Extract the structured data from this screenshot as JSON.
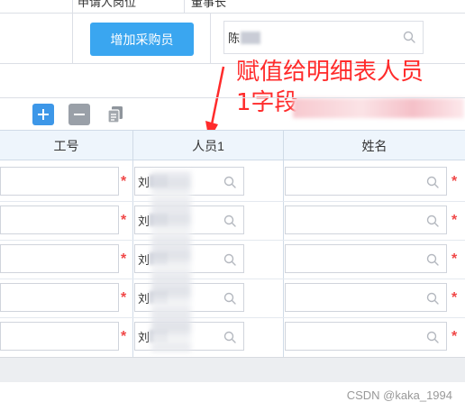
{
  "top_form": {
    "applicant_position_label": "申请人岗位",
    "applicant_position_value": "董事长",
    "add_buyer_button": "增加采购员",
    "person_field_value": "陈"
  },
  "annotation": {
    "line1": "赋值给明细表人员",
    "line2": "1字段"
  },
  "toolbar": {
    "icons": [
      "add-icon",
      "remove-icon",
      "copy-icon"
    ]
  },
  "table": {
    "columns": [
      "工号",
      "人员1",
      "姓名"
    ],
    "rows": [
      {
        "person": "刘"
      },
      {
        "person": "刘"
      },
      {
        "person": "刘"
      },
      {
        "person": "刘"
      },
      {
        "person": "刘"
      }
    ]
  },
  "colors": {
    "accent_button": "#3aa6f0",
    "annotation": "#ff2b2b",
    "required_star": "#f04848",
    "header_bg": "#eef5fc"
  },
  "watermark": "CSDN @kaka_1994"
}
